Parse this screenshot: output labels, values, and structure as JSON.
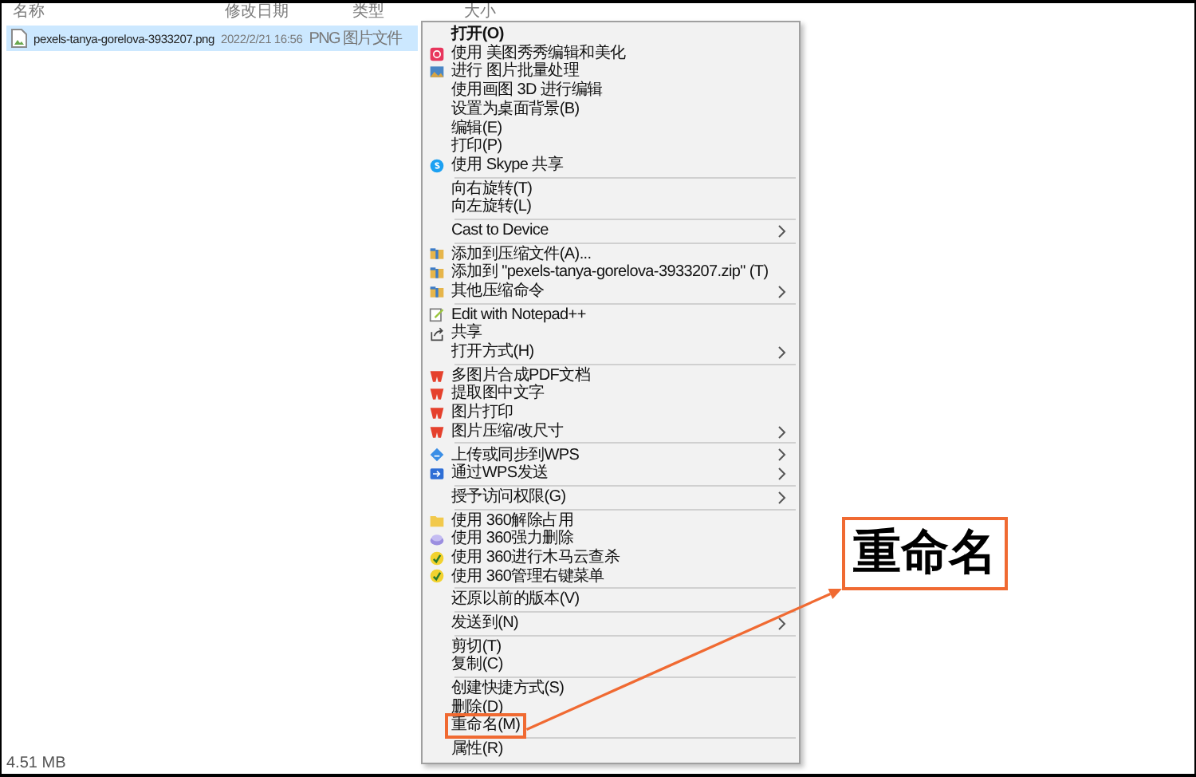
{
  "columns": [
    "名称",
    "修改日期",
    "类型",
    "大小"
  ],
  "files": [
    {
      "name": "pexels-tanya-gorelova-3933207.png",
      "modified": "2022/2/21 16:56",
      "type": "PNG 图片文件",
      "selected": true
    }
  ],
  "context_menu": {
    "groups": [
      [
        {
          "label": "打开(O)",
          "kind": "text",
          "default": true,
          "submenu": false
        },
        {
          "label": "使用 美图秀秀编辑和美化",
          "kind": "meitu",
          "submenu": false
        },
        {
          "label": "进行 图片批量处理",
          "kind": "image",
          "submenu": false
        },
        {
          "label": "使用画图 3D 进行编辑",
          "kind": "text",
          "submenu": false
        },
        {
          "label": "设置为桌面背景(B)",
          "kind": "text",
          "submenu": false
        },
        {
          "label": "编辑(E)",
          "kind": "text",
          "submenu": false
        },
        {
          "label": "打印(P)",
          "kind": "text",
          "submenu": false
        },
        {
          "label": "使用 Skype 共享",
          "kind": "skype",
          "submenu": false
        }
      ],
      [
        {
          "label": "向右旋转(T)",
          "kind": "text",
          "submenu": false
        },
        {
          "label": "向左旋转(L)",
          "kind": "text",
          "submenu": false
        }
      ],
      [
        {
          "label": "Cast to Device",
          "kind": "text",
          "submenu": true
        }
      ],
      [
        {
          "label": "添加到压缩文件(A)...",
          "kind": "archive",
          "submenu": false
        },
        {
          "label": "添加到 \"pexels-tanya-gorelova-3933207.zip\" (T)",
          "kind": "archive",
          "submenu": false
        },
        {
          "label": "其他压缩命令",
          "kind": "archive",
          "submenu": true
        }
      ],
      [
        {
          "label": "Edit with Notepad++",
          "kind": "notepad",
          "submenu": false
        },
        {
          "label": "共享",
          "kind": "share",
          "submenu": false
        },
        {
          "label": "打开方式(H)",
          "kind": "text",
          "submenu": true
        }
      ],
      [
        {
          "label": "多图片合成PDF文档",
          "kind": "wps",
          "submenu": false
        },
        {
          "label": "提取图中文字",
          "kind": "wps",
          "submenu": false
        },
        {
          "label": "图片打印",
          "kind": "wps",
          "submenu": false
        },
        {
          "label": "图片压缩/改尺寸",
          "kind": "wps",
          "submenu": true
        }
      ],
      [
        {
          "label": "上传或同步到WPS",
          "kind": "cloud",
          "submenu": true
        },
        {
          "label": "通过WPS发送",
          "kind": "send",
          "submenu": true
        }
      ],
      [
        {
          "label": "授予访问权限(G)",
          "kind": "text",
          "submenu": true
        }
      ],
      [
        {
          "label": "使用 360解除占用",
          "kind": "folder",
          "submenu": false
        },
        {
          "label": "使用 360强力删除",
          "kind": "eraser",
          "submenu": false
        },
        {
          "label": "使用 360进行木马云查杀",
          "kind": "shield",
          "submenu": false
        },
        {
          "label": "使用 360管理右键菜单",
          "kind": "shield",
          "submenu": false
        }
      ],
      [
        {
          "label": "还原以前的版本(V)",
          "kind": "text",
          "submenu": false
        }
      ],
      [
        {
          "label": "发送到(N)",
          "kind": "text",
          "submenu": true
        }
      ],
      [
        {
          "label": "剪切(T)",
          "kind": "text",
          "submenu": false
        },
        {
          "label": "复制(C)",
          "kind": "text",
          "submenu": false
        }
      ],
      [
        {
          "label": "创建快捷方式(S)",
          "kind": "text",
          "submenu": false
        },
        {
          "label": "删除(D)",
          "kind": "text",
          "submenu": false
        },
        {
          "label": "重命名(M)",
          "kind": "text",
          "submenu": false,
          "annotated": true
        }
      ],
      [
        {
          "label": "属性(R)",
          "kind": "text",
          "submenu": false
        }
      ]
    ]
  },
  "callout": {
    "text": "重命名"
  },
  "status_bar": "4.51 MB"
}
